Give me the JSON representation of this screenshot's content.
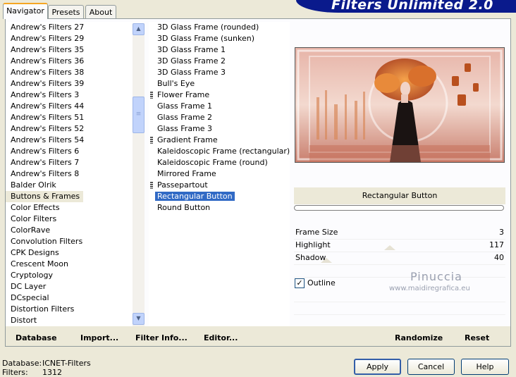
{
  "tabs": [
    "Navigator",
    "Presets",
    "About"
  ],
  "banner_title": "Filters Unlimited 2.0",
  "categories": [
    "Andrew's Filters 27",
    "Andrew's Filters 29",
    "Andrew's Filters 35",
    "Andrew's Filters 36",
    "Andrew's Filters 38",
    "Andrew's Filters 39",
    "Andrew's Filters 3",
    "Andrew's Filters 44",
    "Andrew's Filters 51",
    "Andrew's Filters 52",
    "Andrew's Filters 54",
    "Andrew's Filters 6",
    "Andrew's Filters 7",
    "Andrew's Filters 8",
    "Balder Olrik",
    "Buttons & Frames",
    "Color Effects",
    "Color Filters",
    "ColorRave",
    "Convolution Filters",
    "CPK Designs",
    "Crescent Moon",
    "Cryptology",
    "DC Layer",
    "DCspecial",
    "Distortion Filters",
    "Distort"
  ],
  "selected_category": "Buttons & Frames",
  "filters": [
    {
      "label": "3D Glass Frame (rounded)",
      "group": false
    },
    {
      "label": "3D Glass Frame (sunken)",
      "group": false
    },
    {
      "label": "3D Glass Frame 1",
      "group": false
    },
    {
      "label": "3D Glass Frame 2",
      "group": false
    },
    {
      "label": "3D Glass Frame 3",
      "group": false
    },
    {
      "label": "Bull's Eye",
      "group": false
    },
    {
      "label": "Flower Frame",
      "group": true
    },
    {
      "label": "Glass Frame 1",
      "group": false
    },
    {
      "label": "Glass Frame 2",
      "group": false
    },
    {
      "label": "Glass Frame 3",
      "group": false
    },
    {
      "label": "Gradient Frame",
      "group": true
    },
    {
      "label": "Kaleidoscopic Frame (rectangular)",
      "group": false
    },
    {
      "label": "Kaleidoscopic Frame (round)",
      "group": false
    },
    {
      "label": "Mirrored Frame",
      "group": false
    },
    {
      "label": "Passepartout",
      "group": true
    },
    {
      "label": "Rectangular Button",
      "group": false
    },
    {
      "label": "Round Button",
      "group": false
    }
  ],
  "selected_filter": "Rectangular Button",
  "filter_name": "Rectangular Button",
  "params": {
    "frame_size": {
      "label": "Frame Size",
      "value": "3"
    },
    "highlight": {
      "label": "Highlight",
      "value": "117"
    },
    "shadow": {
      "label": "Shadow",
      "value": "40"
    }
  },
  "outline": {
    "label": "Outline",
    "checked": true
  },
  "watermark": {
    "line1": "Pinuccia",
    "line2": "www.maidiregrafica.eu"
  },
  "bottom_links": {
    "database": "Database",
    "import": "Import...",
    "filter_info": "Filter Info...",
    "editor": "Editor...",
    "randomize": "Randomize",
    "reset": "Reset"
  },
  "status": {
    "database_label": "Database:",
    "database_value": "ICNET-Filters",
    "filters_label": "Filters:",
    "filters_value": "1312"
  },
  "buttons": {
    "apply": "Apply",
    "cancel": "Cancel",
    "help": "Help"
  },
  "colors": {
    "selection": "#316ac5",
    "banner": "#0a1a8c",
    "tab_accent": "#f5a623"
  }
}
